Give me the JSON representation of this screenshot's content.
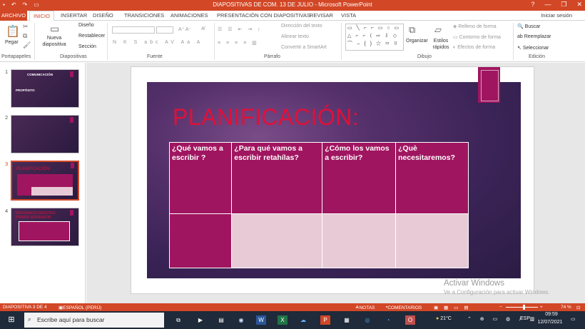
{
  "titlebar": {
    "title": "DIAPOSITIVAS DE COM. 13 DE JULIO - Microsoft PowerPoint",
    "qat": [
      "save-icon",
      "undo-icon",
      "redo-icon",
      "present-icon"
    ],
    "help": "?",
    "minimize": "—",
    "restore": "❐",
    "close": "✕"
  },
  "tabs": {
    "file": "ARCHIVO",
    "items": [
      "INICIO",
      "INSERTAR",
      "DISEÑO",
      "TRANSICIONES",
      "ANIMACIONES",
      "PRESENTACIÓN CON DIAPOSITIVAS",
      "REVISAR",
      "VISTA"
    ],
    "active": "INICIO",
    "signin": "Iniciar sesión"
  },
  "ribbon": {
    "clipboard": {
      "paste": "Pegar",
      "group": "Portapapeles"
    },
    "slides": {
      "new_slide": "Nueva diapositiva",
      "layout": "Diseño",
      "reset": "Restablecer",
      "section": "Sección",
      "group": "Diapositivas"
    },
    "font": {
      "group": "Fuente"
    },
    "paragraph": {
      "text_direction": "Dirección del texto",
      "align_text": "Alinear texto",
      "smartart": "Convertir a SmartArt",
      "group": "Párrafo"
    },
    "drawing": {
      "arrange": "Organizar",
      "quick_styles": "Estilos rápidos",
      "fill": "Relleno de forma",
      "outline": "Contorno de forma",
      "effects": "Efectos de forma",
      "group": "Dibujo"
    },
    "editing": {
      "find": "Buscar",
      "replace": "Reemplazar",
      "select": "Seleccionar",
      "group": "Edición"
    }
  },
  "thumbnails": [
    {
      "num": "1",
      "line1": "COMUNICACIÓN",
      "line2": "PROPÓSITO",
      "selected": false
    },
    {
      "num": "2",
      "line1": "",
      "line2": "",
      "selected": false
    },
    {
      "num": "3",
      "line1": "PLANIFICACIÓN:",
      "line2": "",
      "selected": true
    },
    {
      "num": "4",
      "line1": "REVISAMOS NUESTRO",
      "line2": "PRIMER BORRADOR",
      "selected": false
    }
  ],
  "slide": {
    "title": "PLANIFICACIÓN:",
    "table": {
      "headers": [
        "¿Qué vamos a escribir ?",
        "¿Para qué vamos a escribir retahílas?",
        "¿Cómo los vamos a escribir?",
        "¿Què necesitaremos?"
      ],
      "row2": [
        "",
        "",
        "",
        ""
      ]
    },
    "colors": {
      "magenta": "#a01560",
      "title": "#e0103a",
      "pale": "#e7cad6"
    }
  },
  "watermark": {
    "line1": "Activar Windows",
    "line2": "Ve a Configuración para activar Windows."
  },
  "status": {
    "slide": "DIAPOSITIVA 3 DE 4",
    "language": "ESPAÑOL (PERÚ)",
    "notes": "NOTAS",
    "comments": "COMENTARIOS",
    "zoom": "74 %"
  },
  "taskbar": {
    "search_placeholder": "Escribe aquí para buscar",
    "weather": "21°C",
    "lang": "ESP",
    "time": "09:59",
    "date": "12/07/2021"
  }
}
